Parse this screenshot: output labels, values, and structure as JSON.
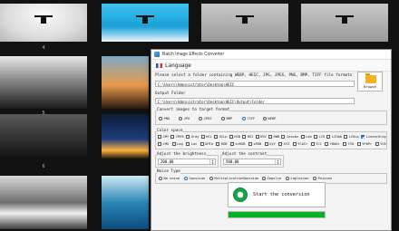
{
  "gallery": {
    "captions": [
      "4",
      "",
      "",
      "5",
      "",
      "",
      "6",
      "",
      "",
      "",
      "",
      ""
    ]
  },
  "window": {
    "title": "Batch Image Effects Converter",
    "menu": {
      "language": "Language"
    },
    "select_folder_label": "Please select a folder containing WEBP, HEIC, JPG, JPEG, PNG, BMP, TIFF file formats",
    "input_path": "C:\\Users\\Administrator\\Desktop\\HEIC",
    "browse_label": "Browse",
    "output_folder_label": "Output Folder",
    "output_path": "C:\\Users\\Administrator\\Desktop\\HEIC\\Output\\Folder",
    "convert_group_label": "Convert images to target format",
    "formats": [
      {
        "label": "PNG",
        "selected": false
      },
      {
        "label": "JPG",
        "selected": false
      },
      {
        "label": "JPEG",
        "selected": false
      },
      {
        "label": "BMP",
        "selected": false
      },
      {
        "label": "TIFF",
        "selected": true
      },
      {
        "label": "WEBP",
        "selected": false
      }
    ],
    "color_group_label": "Color space",
    "color_row1": [
      {
        "label": "CMY",
        "checked": false
      },
      {
        "label": "CMYK",
        "checked": false
      },
      {
        "label": "Gray",
        "checked": false
      },
      {
        "label": "HCL",
        "checked": false
      },
      {
        "label": "HCLp",
        "checked": false
      },
      {
        "label": "HSB",
        "checked": false
      },
      {
        "label": "HSI",
        "checked": false
      },
      {
        "label": "HSV",
        "checked": false
      },
      {
        "label": "HWB",
        "checked": false
      },
      {
        "label": "Jzazbz",
        "checked": false
      },
      {
        "label": "Lab",
        "checked": false
      },
      {
        "label": "LCH",
        "checked": false
      },
      {
        "label": "LCHab",
        "checked": false
      },
      {
        "label": "LCHuv",
        "checked": false
      },
      {
        "label": "LinearGray",
        "checked": true
      }
    ],
    "color_row2": [
      {
        "label": "LMS",
        "checked": false
      },
      {
        "label": "Log",
        "checked": false
      },
      {
        "label": "Luv",
        "checked": false
      },
      {
        "label": "OHTa",
        "checked": false
      },
      {
        "label": "RGB",
        "checked": false
      },
      {
        "label": "scRGB",
        "checked": false
      },
      {
        "label": "sRGB",
        "checked": false
      },
      {
        "label": "XyY",
        "checked": false
      },
      {
        "label": "XYZ",
        "checked": false
      },
      {
        "label": "YCbCr",
        "checked": false
      },
      {
        "label": "YCC",
        "checked": false
      },
      {
        "label": "YDbDr",
        "checked": false
      },
      {
        "label": "YIQ",
        "checked": false
      },
      {
        "label": "YPbPr",
        "checked": false
      },
      {
        "label": "YUV",
        "checked": false
      }
    ],
    "brightness_label": "Adjust the brightness",
    "brightness_value": "200.00",
    "contrast_label": "Adjust the contrast",
    "contrast_value": "500.00",
    "noise_group_label": "Noise Type",
    "noise_options": [
      {
        "label": "No noise",
        "selected": false
      },
      {
        "label": "Gaussian",
        "selected": true
      },
      {
        "label": "MultiplicativeGaussian",
        "selected": false
      },
      {
        "label": "Impulse",
        "selected": false
      },
      {
        "label": "Laplacian",
        "selected": false
      },
      {
        "label": "Poisson",
        "selected": false
      }
    ],
    "start_label": "Start the conversion",
    "progress": 1.0,
    "colors": {
      "progress": "#06b025",
      "start_icon": "#17a34a",
      "radio_accent": "#1f6fd1",
      "folder": "#f3b21e"
    },
    "icons": [
      "app-icon",
      "language-flag-icon",
      "folder-icon",
      "refresh-icon"
    ]
  }
}
